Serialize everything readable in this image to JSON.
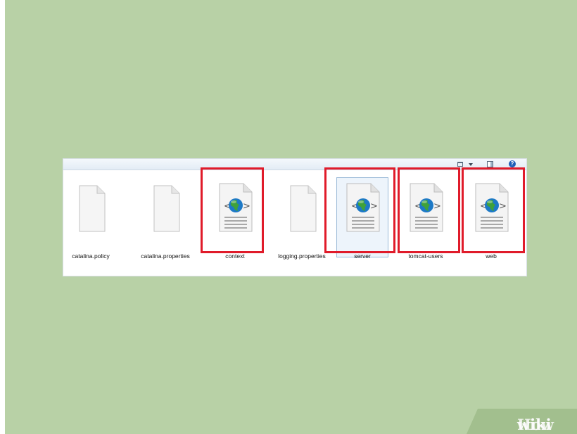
{
  "files": [
    {
      "name": "catalina.policy",
      "type": "blank-file"
    },
    {
      "name": "catalina.properties",
      "type": "blank-file"
    },
    {
      "name": "context",
      "type": "xml-file",
      "highlighted": true
    },
    {
      "name": "logging.properties",
      "type": "blank-file"
    },
    {
      "name": "server",
      "type": "xml-file",
      "highlighted": true,
      "selected": true
    },
    {
      "name": "tomcat-users",
      "type": "xml-file",
      "highlighted": true
    },
    {
      "name": "web",
      "type": "xml-file",
      "highlighted": true
    }
  ],
  "toolbar": {
    "views_icon": "views-icon",
    "dropdown_icon": "chevron-down-icon",
    "preview_pane_icon": "preview-pane-icon",
    "help_icon": "help-icon",
    "help_glyph": "?"
  },
  "highlight_color": "#e01b2a",
  "background_color": "#b8d1a6",
  "watermark": {
    "part1": "wiki",
    "part2": "How"
  }
}
